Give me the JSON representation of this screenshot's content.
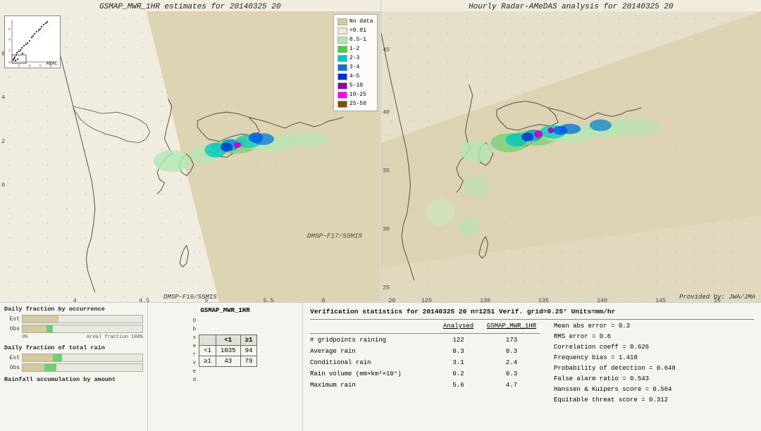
{
  "left_map": {
    "title": "GSMAP_MWR_1HR estimates for 20140325 20",
    "bottom_label": "DMSP-F16/SSMIS",
    "scatter_label": "ANAL"
  },
  "right_map": {
    "title": "Hourly Radar-AMeDAS analysis for 20140325 20",
    "bottom_label_right": "Provided by: JWA/JMA"
  },
  "legend": {
    "items": [
      {
        "label": "No data",
        "color": "#d4c9a0"
      },
      {
        "label": "<0.01",
        "color": "#e8e4cc"
      },
      {
        "label": "0.5-1",
        "color": "#b8e8b8"
      },
      {
        "label": "1-2",
        "color": "#70d870"
      },
      {
        "label": "2-3",
        "color": "#00c8c8"
      },
      {
        "label": "3-4",
        "color": "#0090f0"
      },
      {
        "label": "4-5",
        "color": "#0040e0"
      },
      {
        "label": "5-10",
        "color": "#8000c0"
      },
      {
        "label": "10-25",
        "color": "#ff00ff"
      },
      {
        "label": "25-50",
        "color": "#804000"
      }
    ]
  },
  "bar_charts": {
    "occurrence_title": "Daily fraction by occurrence",
    "rain_title": "Daily fraction of total rain",
    "accumulation_title": "Rainfall accumulation by amount",
    "est_label": "Est",
    "obs_label": "Obs",
    "axis_start": "0%",
    "axis_end": "Areal fraction  100%"
  },
  "contingency": {
    "title": "GSMAP_MWR_1HR",
    "header_lt1": "<1",
    "header_ge1": "≥1",
    "row_lt1": "<1",
    "row_ge1": "≥1",
    "observed_label": "O\nb\ns\ne\nr\nv\ne\nd",
    "val_lt1_lt1": "1035",
    "val_lt1_ge1": "94",
    "val_ge1_lt1": "43",
    "val_ge1_ge1": "79"
  },
  "verification": {
    "title": "Verification statistics for 20140325 20  n=1251  Verif. grid=0.25°  Units=mm/hr",
    "col_analysed": "Analysed",
    "col_gsmap": "GSMAP_MWR_1HR",
    "rows": [
      {
        "label": "# gridpoints raining",
        "analysed": "122",
        "gsmap": "173"
      },
      {
        "label": "Average rain",
        "analysed": "0.3",
        "gsmap": "0.3"
      },
      {
        "label": "Conditional rain",
        "analysed": "3.1",
        "gsmap": "2.4"
      },
      {
        "label": "Rain volume (mm×km²×10⁶)",
        "analysed": "0.2",
        "gsmap": "0.3"
      },
      {
        "label": "Maximum rain",
        "analysed": "5.6",
        "gsmap": "4.7"
      }
    ],
    "stats": [
      {
        "label": "Mean abs error = 0.3"
      },
      {
        "label": "RMS error = 0.6"
      },
      {
        "label": "Correlation coeff = 0.626"
      },
      {
        "label": "Frequency bias = 1.418"
      },
      {
        "label": "Probability of detection = 0.648"
      },
      {
        "label": "False alarm ratio = 0.543"
      },
      {
        "label": "Hanssen & Kuipers score = 0.564"
      },
      {
        "label": "Equitable threat score = 0.312"
      }
    ]
  }
}
